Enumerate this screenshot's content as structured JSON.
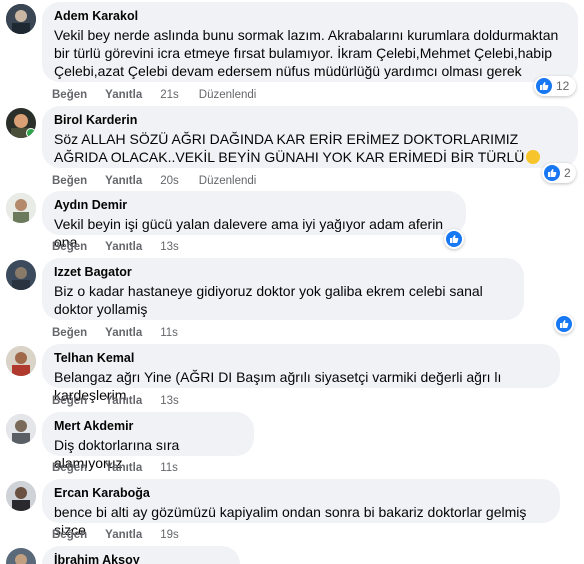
{
  "actions": {
    "like": "Beğen",
    "reply": "Yanıtla"
  },
  "comments": [
    {
      "author": "Adem Karakol",
      "text": "Vekil bey nerde aslında bunu sormak lazım. Akrabalarını kurumlara doldurmaktan bir türlü görevini icra etmeye fırsat bulamıyor. İkram Çelebi,Mehmet Çelebi,habip Çelebi,azat Çelebi devam edersem nüfus müdürlüğü yardımcı olması gerek",
      "time": "21s",
      "edited": "Düzenlendi",
      "reactions": "12"
    },
    {
      "author": "Birol Karderin",
      "text": "Söz ALLAH SÖZÜ AĞRI DAĞINDA KAR ERİR ERİMEZ DOKTORLARIMIZ AĞRIDA OLACAK..VEKİL BEYİN GÜNAHI YOK KAR ERİMEDİ BİR TÜRLÜ",
      "time": "20s",
      "edited": "Düzenlendi",
      "reactions": "2"
    },
    {
      "author": "Aydın Demir",
      "text": "Vekil beyin işi gücü yalan dalevere ama iyi yağıyor adam aferin ona",
      "time": "13s"
    },
    {
      "author": "Izzet Bagator",
      "text": "Biz o kadar hastaneye gidiyoruz doktor yok galiba ekrem celebi sanal doktor yollamiş",
      "time": "11s"
    },
    {
      "author": "Telhan Kemal",
      "text": "Belangaz ağrı Yine (AĞRI DI Başım ağrılı siyasetçi varmiki değerli ağrı lı kardeşlerim",
      "time": "13s"
    },
    {
      "author": "Mert Akdemir",
      "text": "Diş doktorlarına sıra alamıyoruz",
      "time": "11s"
    },
    {
      "author": "Ercan Karaboğa",
      "text": "bence bi alti ay gözümüzü kapiyalim ondan sonra bi bakariz doktorlar gelmiş sizce",
      "time": "19s"
    },
    {
      "author": "İbrahim Aksoy"
    }
  ],
  "colors": {
    "like_blue": "#1877f2",
    "bubble": "#f0f2f5",
    "meta": "#65676b"
  }
}
